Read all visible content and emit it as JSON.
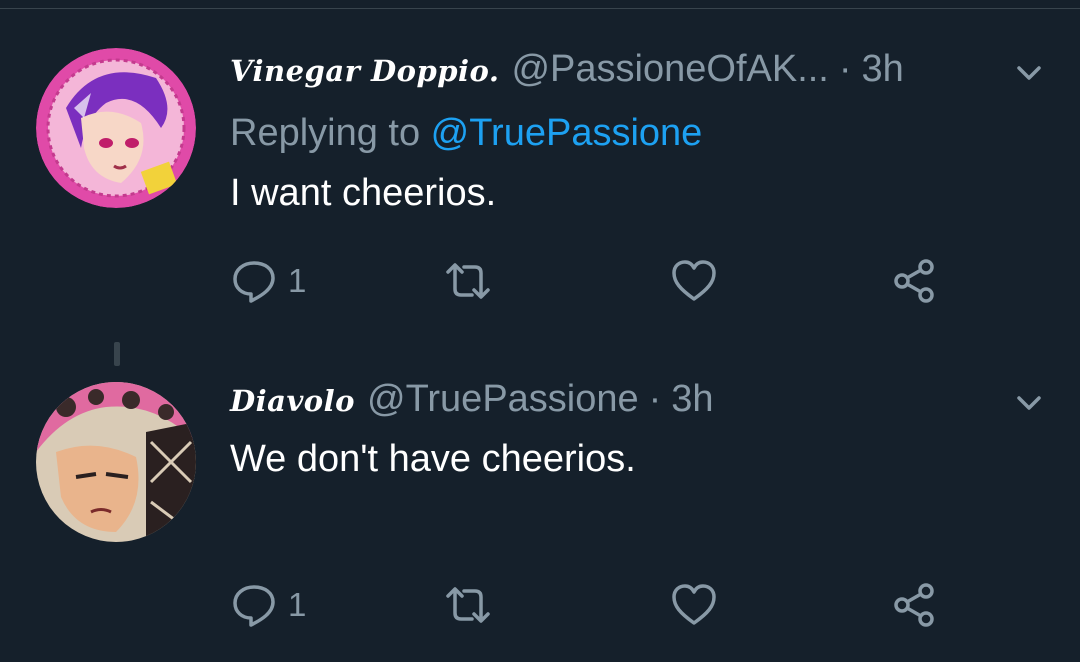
{
  "colors": {
    "background": "#15202b",
    "secondary_text": "#8899a6",
    "link": "#1da1f2",
    "divider": "#38444d"
  },
  "tweets": [
    {
      "display_name": "Vinegar Doppio.",
      "handle": "@PassioneOfAK...",
      "separator": "·",
      "time": "3h",
      "reply_prefix": "Replying to ",
      "reply_mention": "@TruePassione",
      "text": "I want cheerios.",
      "reply_count": "1"
    },
    {
      "display_name": "Diavolo",
      "handle": "@TruePassione",
      "separator": "·",
      "time": "3h",
      "text": "We don't have cheerios.",
      "reply_count": "1"
    }
  ],
  "icons": [
    "chevron-down-icon",
    "reply-icon",
    "retweet-icon",
    "like-icon",
    "share-icon"
  ]
}
